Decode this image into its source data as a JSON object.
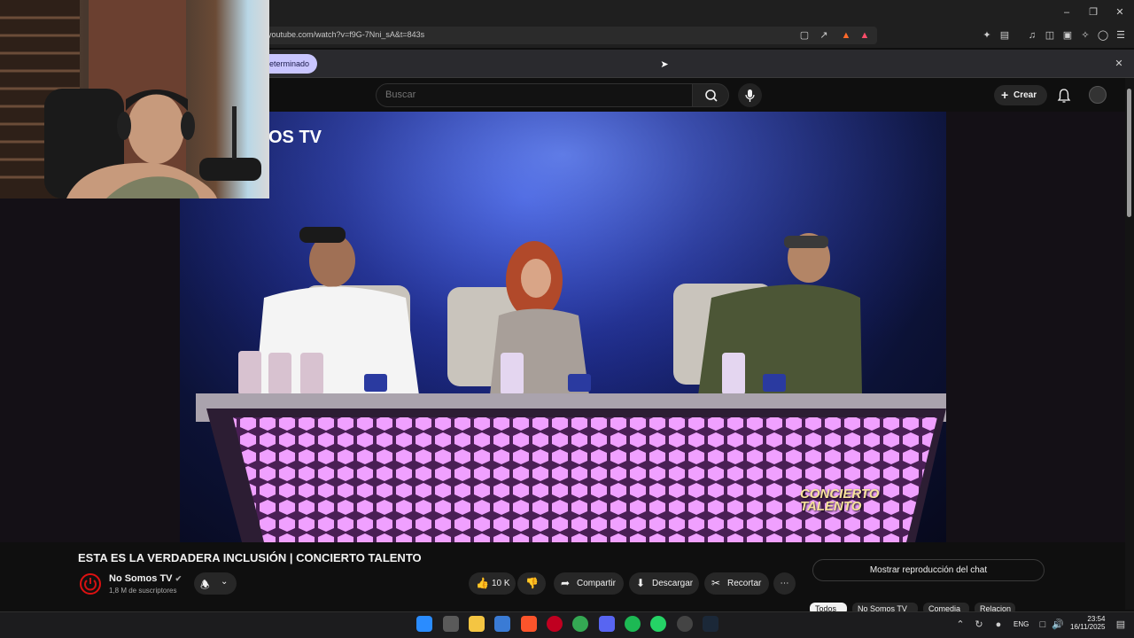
{
  "browser": {
    "url": "youtube.com/watch?v=f9G-7Nni_sA&t=843s",
    "infobar_pill": "eterminado"
  },
  "youtube": {
    "search_placeholder": "Buscar",
    "create_label": "Crear"
  },
  "video": {
    "channel_logo_text": "OS TV",
    "show_logo_text": "CONCIERTO TALENTO",
    "title": "ESTA ES LA VERDADERA INCLUSIÓN | CONCIERTO TALENTO",
    "channel": "No Somos TV",
    "subscribers": "1,8 M de suscriptores",
    "likes": "10 K",
    "share_label": "Compartir",
    "download_label": "Descargar",
    "clip_label": "Recortar",
    "chat_button": "Mostrar reproducción del chat"
  },
  "chips": [
    "Todos",
    "No Somos TV",
    "Comedia",
    "Relacion"
  ],
  "taskbar": {
    "language": "ENG",
    "time": "23:54",
    "date": "16/11/2025"
  },
  "colors": {
    "accent_pill": "#c9c6ff",
    "stage_blue": "#1d2a8a",
    "desk_glow": "#e080f0",
    "brand_red": "#d11111"
  }
}
